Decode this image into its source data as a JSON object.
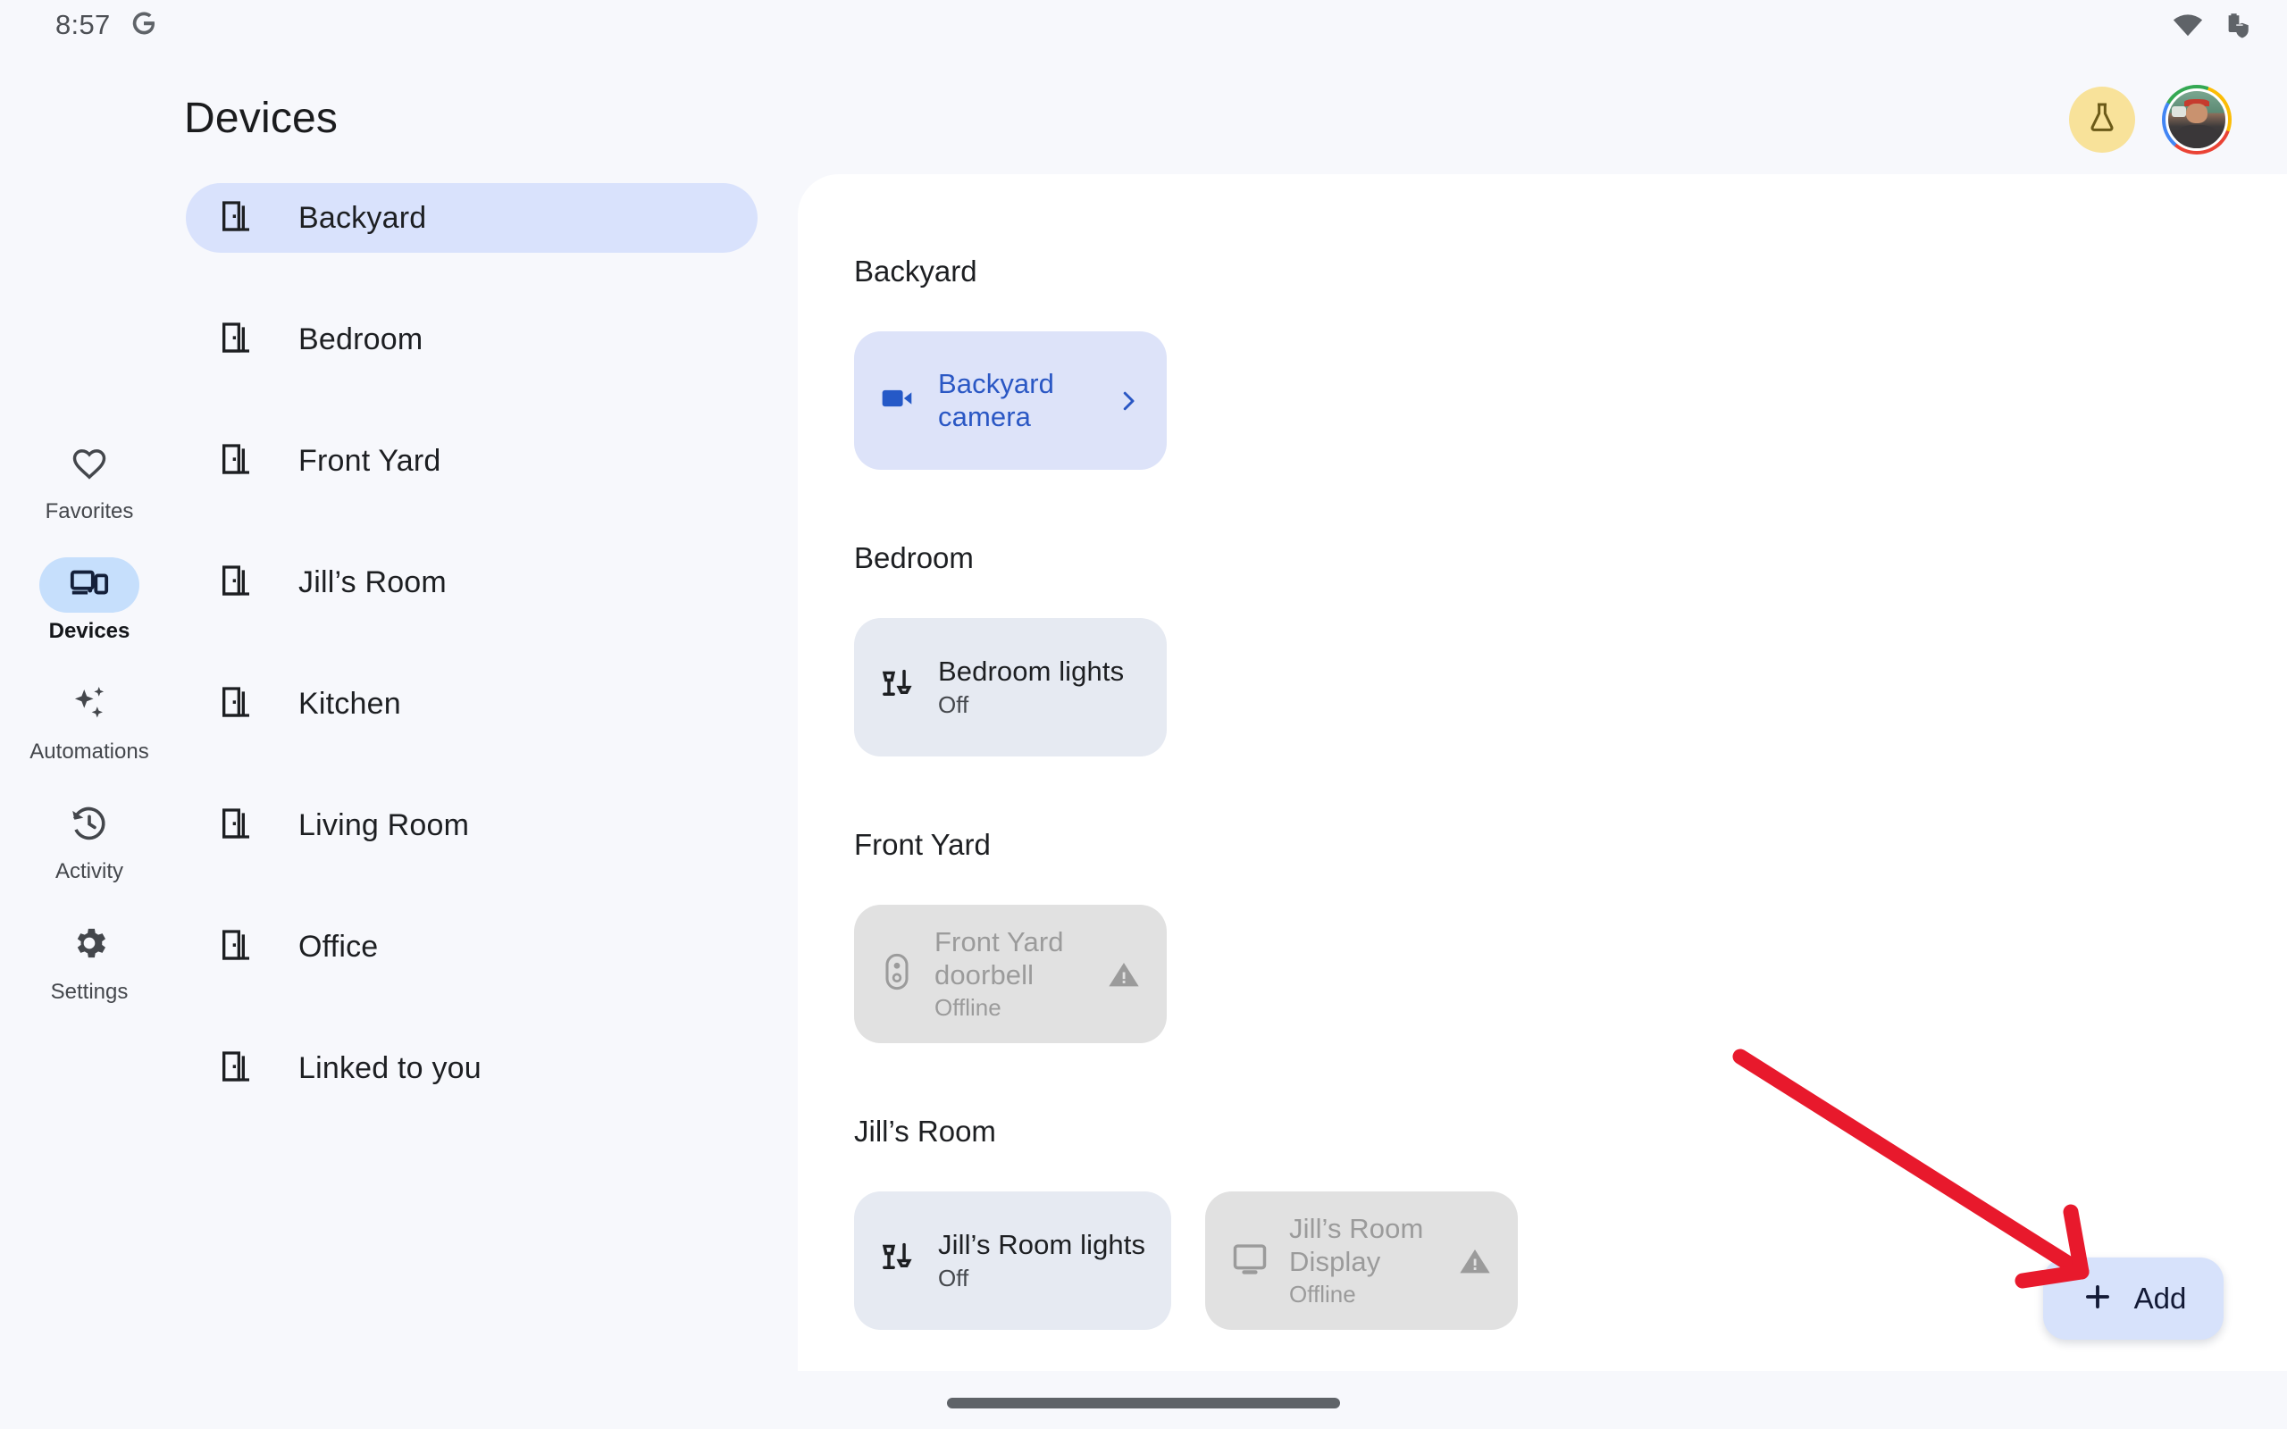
{
  "statusbar": {
    "time": "8:57",
    "google_icon": "google-g-icon",
    "wifi_icon": "wifi-icon",
    "battery_icon": "battery-shield-icon"
  },
  "header": {
    "title": "Devices",
    "labs_icon": "flask-icon",
    "avatar_name": "user-avatar"
  },
  "nav_rail": {
    "items": [
      {
        "label": "Favorites",
        "icon": "heart-icon",
        "active": false
      },
      {
        "label": "Devices",
        "icon": "devices-icon",
        "active": true
      },
      {
        "label": "Automations",
        "icon": "sparkles-icon",
        "active": false
      },
      {
        "label": "Activity",
        "icon": "history-icon",
        "active": false
      },
      {
        "label": "Settings",
        "icon": "gear-icon",
        "active": false
      }
    ]
  },
  "rooms": {
    "items": [
      {
        "label": "Backyard",
        "icon": "door-icon",
        "selected": true
      },
      {
        "label": "Bedroom",
        "icon": "door-icon",
        "selected": false
      },
      {
        "label": "Front Yard",
        "icon": "door-icon",
        "selected": false
      },
      {
        "label": "Jill’s Room",
        "icon": "door-icon",
        "selected": false
      },
      {
        "label": "Kitchen",
        "icon": "door-icon",
        "selected": false
      },
      {
        "label": "Living Room",
        "icon": "door-icon",
        "selected": false
      },
      {
        "label": "Office",
        "icon": "door-icon",
        "selected": false
      },
      {
        "label": "Linked to you",
        "icon": "door-icon",
        "selected": false
      }
    ]
  },
  "main": {
    "groups": [
      {
        "title": "Backyard",
        "devices": [
          {
            "name": "Backyard camera",
            "state": "",
            "icon": "video-camera-icon",
            "style": "cam",
            "trailing": "chevron-right-icon"
          }
        ]
      },
      {
        "title": "Bedroom",
        "devices": [
          {
            "name": "Bedroom lights",
            "state": "Off",
            "icon": "lamp-icon",
            "style": "light",
            "trailing": ""
          }
        ]
      },
      {
        "title": "Front Yard",
        "devices": [
          {
            "name": "Front Yard doorbell",
            "state": "Offline",
            "icon": "doorbell-icon",
            "style": "offline",
            "trailing": "warning-icon"
          }
        ]
      },
      {
        "title": "Jill’s Room",
        "devices": [
          {
            "name": "Jill’s Room lights",
            "state": "Off",
            "icon": "lamp-icon",
            "style": "light",
            "trailing": ""
          },
          {
            "name": "Jill’s Room Display",
            "state": "Offline",
            "icon": "display-icon",
            "style": "offline",
            "trailing": "warning-icon"
          }
        ]
      }
    ]
  },
  "fab": {
    "label": "Add",
    "icon": "plus-icon"
  },
  "annotation": {
    "type": "arrow",
    "color": "#e8192c",
    "points_to": "add-button"
  },
  "colors": {
    "page_background": "#f7f8fc",
    "panel_background": "#ffffff",
    "selected_room_pill": "#d9e2fc",
    "nav_active_pill": "#c6dffc",
    "camera_card": "#dde3f9",
    "light_card": "#e6eaf2",
    "offline_card": "#e1e1e1",
    "camera_accent": "#2a57c4",
    "fab_background": "#d7e2fb",
    "fab_text": "#131a36",
    "labs_background": "#f8e29a"
  },
  "gesture_bar": {
    "name": "navigation-handle"
  }
}
